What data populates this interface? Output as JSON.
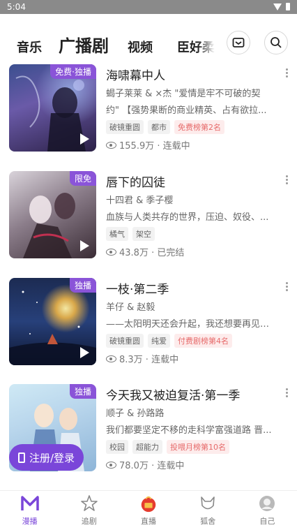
{
  "status_bar": {
    "time": "5:04"
  },
  "top_nav": {
    "tabs": [
      {
        "label": "音乐"
      },
      {
        "label": "广播剧",
        "active": true
      },
      {
        "label": "视频"
      },
      {
        "label": "臣好柔"
      }
    ],
    "mail_icon": "mail-icon",
    "search_icon": "search-icon"
  },
  "items": [
    {
      "badge": "免费·独播",
      "title": "海啸幕中人",
      "author": "蝎子莱莱 & ×杰 \"爱情是牢不可破的契",
      "desc": "约\" 【强势果断的商业精英、占有欲拉...",
      "tags": [
        {
          "text": "破镜重圆",
          "style": "gray"
        },
        {
          "text": "都市",
          "style": "gray"
        },
        {
          "text": "免费榜第2名",
          "style": "red"
        }
      ],
      "stats": "155.9万 · 连载中"
    },
    {
      "badge": "限免",
      "title": "唇下的囚徒",
      "author": "十四君 & 季子樱",
      "desc": "血族与人类共存的世界，压迫、奴役、...",
      "tags": [
        {
          "text": "橘气",
          "style": "gray"
        },
        {
          "text": "架空",
          "style": "gray"
        }
      ],
      "stats": "43.8万 · 已完结"
    },
    {
      "badge": "独播",
      "title": "一枝·第二季",
      "author": "羊仔 & 赵毅",
      "desc": "——太阳明天还会升起，我还想要再见到...",
      "tags": [
        {
          "text": "破镜重圆",
          "style": "gray"
        },
        {
          "text": "纯爱",
          "style": "gray"
        },
        {
          "text": "付费剧榜第4名",
          "style": "red"
        }
      ],
      "stats": "8.3万 · 连载中"
    },
    {
      "badge": "独播",
      "title": "今天我又被迫复活·第一季",
      "author": "顺子 & 孙路路",
      "desc": "我们都要坚定不移的走科学富强道路 晋...",
      "tags": [
        {
          "text": "校园",
          "style": "gray"
        },
        {
          "text": "超能力",
          "style": "gray"
        },
        {
          "text": "投喂月榜第10名",
          "style": "red"
        }
      ],
      "stats": "78.0万 · 连载中"
    }
  ],
  "login_button": {
    "label": "注册/登录"
  },
  "bottom_nav": [
    {
      "label": "漫播",
      "icon": "manbo-logo-icon",
      "active": true
    },
    {
      "label": "追剧",
      "icon": "star-icon"
    },
    {
      "label": "直播",
      "icon": "live-gift-icon"
    },
    {
      "label": "狐舍",
      "icon": "fox-icon"
    },
    {
      "label": "自己",
      "icon": "avatar-icon"
    }
  ],
  "colors": {
    "accent": "#7a46d9",
    "badge": "#8a54d8",
    "rank_tag_text": "#e66a6a"
  }
}
